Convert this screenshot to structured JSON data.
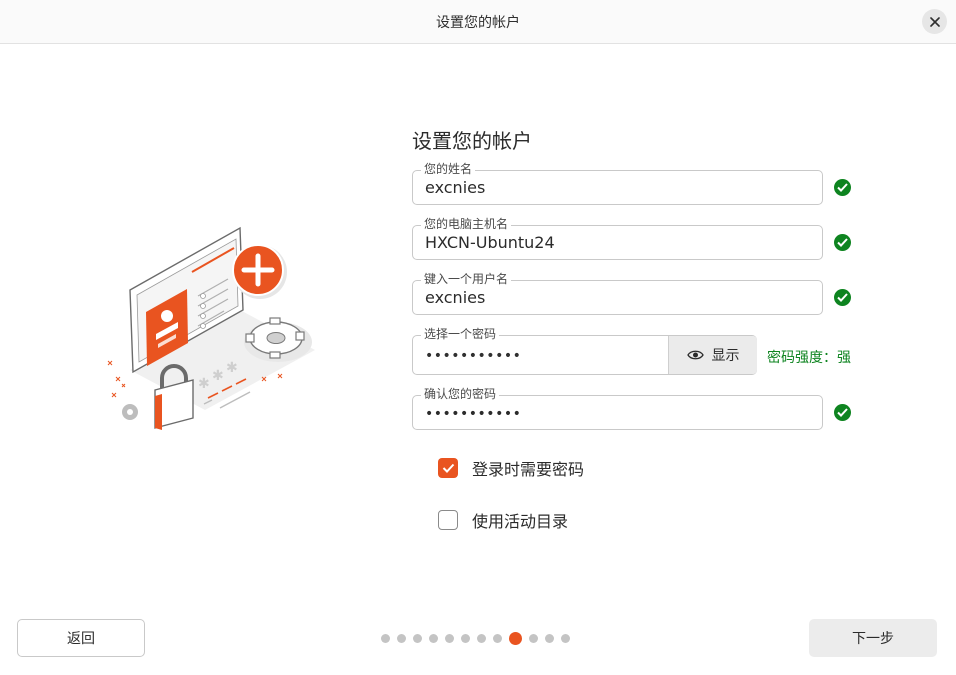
{
  "window": {
    "title": "设置您的帐户",
    "close_icon": "close-icon"
  },
  "form": {
    "heading": "设置您的帐户",
    "fields": [
      {
        "label": "您的姓名",
        "value": "excnies",
        "valid": true
      },
      {
        "label": "您的电脑主机名",
        "value": "HXCN-Ubuntu24",
        "valid": true
      },
      {
        "label": "键入一个用户名",
        "value": "excnies",
        "valid": true
      },
      {
        "label": "选择一个密码",
        "value": "•••••••••••",
        "show_label": "显示",
        "show_icon": "eye-icon"
      },
      {
        "label": "确认您的密码",
        "value": "•••••••••••",
        "valid": true
      }
    ],
    "strength_text": "密码强度：强",
    "options": [
      {
        "label": "登录时需要密码",
        "checked": true
      },
      {
        "label": "使用活动目录",
        "checked": false
      }
    ]
  },
  "footer": {
    "back_label": "返回",
    "next_label": "下一步",
    "page_count": 12,
    "current_page": 9
  },
  "colors": {
    "accent": "#e95420",
    "success": "#0e8420"
  }
}
